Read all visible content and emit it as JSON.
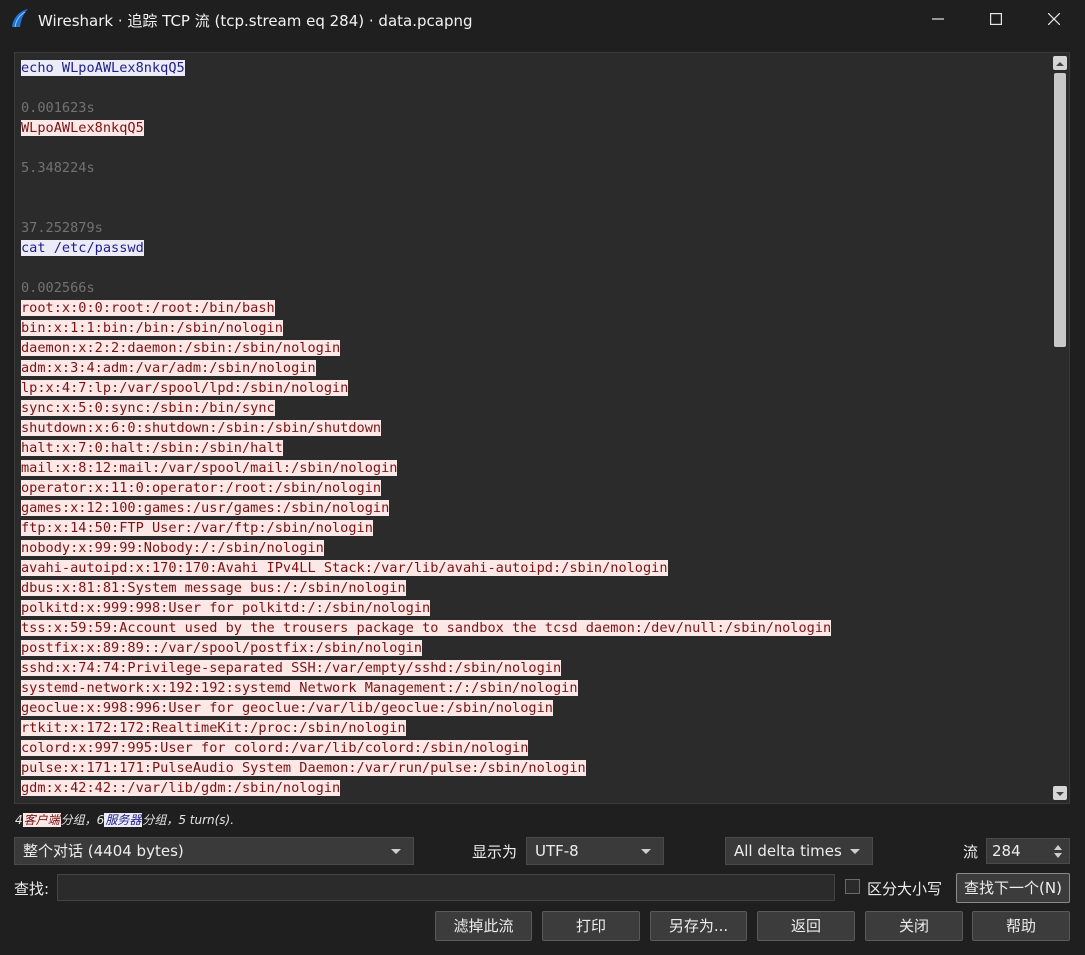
{
  "window": {
    "title": "Wireshark · 追踪 TCP 流 (tcp.stream eq 284) · data.pcapng"
  },
  "icons": {
    "app": "wireshark-fin-icon",
    "minimize": "minimize-icon",
    "maximize": "maximize-icon",
    "close": "close-icon"
  },
  "stream_lines": [
    {
      "type": "client",
      "text": "echo WLpoAWLex8nkqQ5"
    },
    {
      "type": "blank",
      "text": ""
    },
    {
      "type": "ts",
      "text": "0.001623s"
    },
    {
      "type": "server",
      "text": "WLpoAWLex8nkqQ5"
    },
    {
      "type": "blank",
      "text": ""
    },
    {
      "type": "ts",
      "text": "5.348224s"
    },
    {
      "type": "blank",
      "text": ""
    },
    {
      "type": "blank",
      "text": ""
    },
    {
      "type": "ts",
      "text": "37.252879s"
    },
    {
      "type": "client",
      "text": "cat /etc/passwd"
    },
    {
      "type": "blank",
      "text": ""
    },
    {
      "type": "ts",
      "text": "0.002566s"
    },
    {
      "type": "server",
      "text": "root:x:0:0:root:/root:/bin/bash"
    },
    {
      "type": "server",
      "text": "bin:x:1:1:bin:/bin:/sbin/nologin"
    },
    {
      "type": "server",
      "text": "daemon:x:2:2:daemon:/sbin:/sbin/nologin"
    },
    {
      "type": "server",
      "text": "adm:x:3:4:adm:/var/adm:/sbin/nologin"
    },
    {
      "type": "server",
      "text": "lp:x:4:7:lp:/var/spool/lpd:/sbin/nologin"
    },
    {
      "type": "server",
      "text": "sync:x:5:0:sync:/sbin:/bin/sync"
    },
    {
      "type": "server",
      "text": "shutdown:x:6:0:shutdown:/sbin:/sbin/shutdown"
    },
    {
      "type": "server",
      "text": "halt:x:7:0:halt:/sbin:/sbin/halt"
    },
    {
      "type": "server",
      "text": "mail:x:8:12:mail:/var/spool/mail:/sbin/nologin"
    },
    {
      "type": "server",
      "text": "operator:x:11:0:operator:/root:/sbin/nologin"
    },
    {
      "type": "server",
      "text": "games:x:12:100:games:/usr/games:/sbin/nologin"
    },
    {
      "type": "server",
      "text": "ftp:x:14:50:FTP User:/var/ftp:/sbin/nologin"
    },
    {
      "type": "server",
      "text": "nobody:x:99:99:Nobody:/:/sbin/nologin"
    },
    {
      "type": "server",
      "text": "avahi-autoipd:x:170:170:Avahi IPv4LL Stack:/var/lib/avahi-autoipd:/sbin/nologin"
    },
    {
      "type": "server",
      "text": "dbus:x:81:81:System message bus:/:/sbin/nologin"
    },
    {
      "type": "server",
      "text": "polkitd:x:999:998:User for polkitd:/:/sbin/nologin"
    },
    {
      "type": "server",
      "text": "tss:x:59:59:Account used by the trousers package to sandbox the tcsd daemon:/dev/null:/sbin/nologin"
    },
    {
      "type": "server",
      "text": "postfix:x:89:89::/var/spool/postfix:/sbin/nologin"
    },
    {
      "type": "server",
      "text": "sshd:x:74:74:Privilege-separated SSH:/var/empty/sshd:/sbin/nologin"
    },
    {
      "type": "server",
      "text": "systemd-network:x:192:192:systemd Network Management:/:/sbin/nologin"
    },
    {
      "type": "server",
      "text": "geoclue:x:998:996:User for geoclue:/var/lib/geoclue:/sbin/nologin"
    },
    {
      "type": "server",
      "text": "rtkit:x:172:172:RealtimeKit:/proc:/sbin/nologin"
    },
    {
      "type": "server",
      "text": "colord:x:997:995:User for colord:/var/lib/colord:/sbin/nologin"
    },
    {
      "type": "server",
      "text": "pulse:x:171:171:PulseAudio System Daemon:/var/run/pulse:/sbin/nologin"
    },
    {
      "type": "server",
      "text": "gdm:x:42:42::/var/lib/gdm:/sbin/nologin"
    }
  ],
  "summary": {
    "client_count": "4",
    "client_label": "客户端",
    "mid1": "分组，",
    "server_count": "6",
    "server_label": "服务器",
    "mid2": "分组，5 turn(s)."
  },
  "controls": {
    "conversation_select": "整个对话 (4404 bytes)",
    "show_as_label": "显示为",
    "encoding_select": "UTF-8",
    "delta_select": "All delta times",
    "stream_label": "流",
    "stream_value": "284",
    "find_label": "查找:",
    "find_value": "",
    "case_label": "区分大小写",
    "find_next": "查找下一个(N)"
  },
  "buttons": {
    "filter_out": "滤掉此流",
    "print": "打印",
    "save_as": "另存为...",
    "back": "返回",
    "close": "关闭",
    "help": "帮助"
  },
  "colors": {
    "client_bg": "#ececf8",
    "client_fg": "#1e1e8a",
    "server_bg": "#fde8e8",
    "server_fg": "#7a1414",
    "window_bg": "#1f1f1f",
    "pane_bg": "#2b2b2b"
  }
}
